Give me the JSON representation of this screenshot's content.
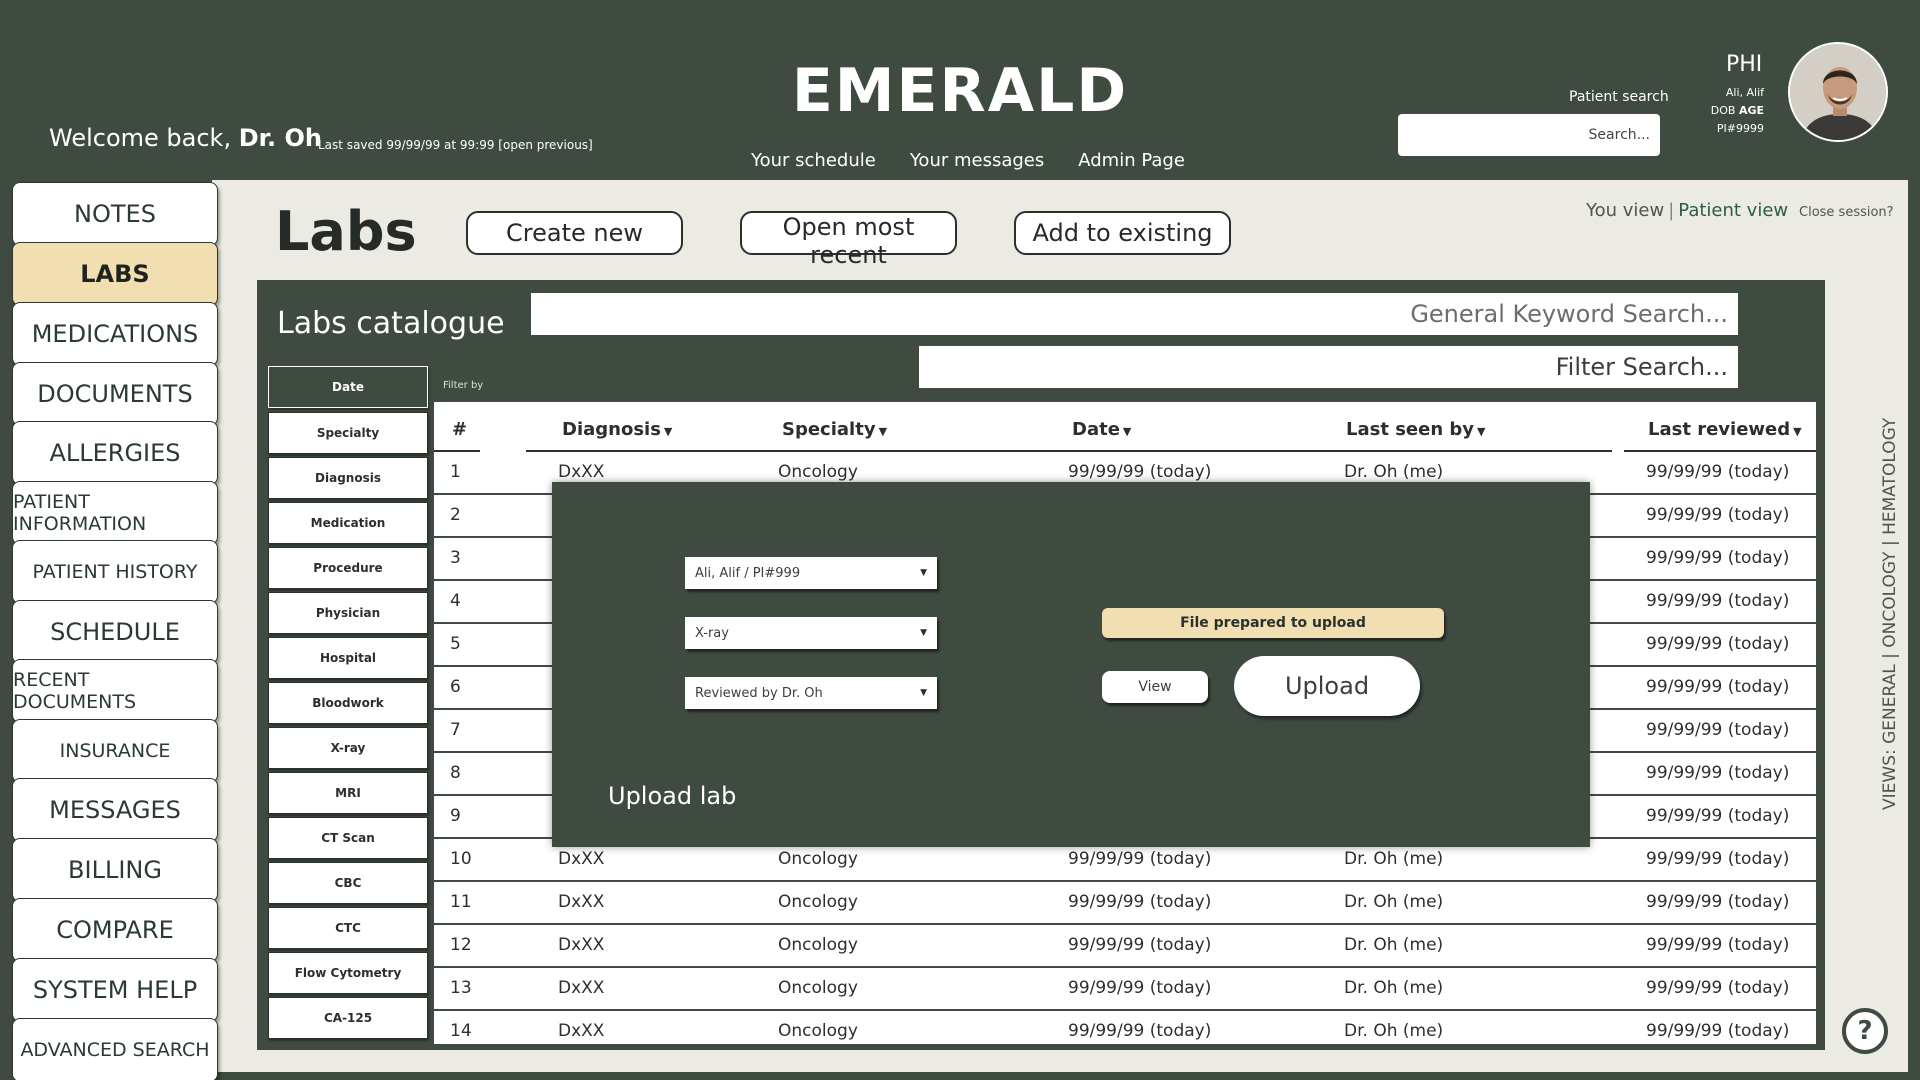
{
  "app": {
    "title": "EMERALD"
  },
  "header": {
    "welcome_prefix": "Welcome back, ",
    "welcome_user": "Dr. Oh",
    "last_saved": "Last saved 99/99/99 at 99:99  [open previous]",
    "nav": [
      "Your schedule",
      "Your messages",
      "Admin Page"
    ],
    "patient_search_label": "Patient search",
    "patient_search_placeholder": "Search..."
  },
  "phi": {
    "title": "PHI",
    "name": "Ali, Alif",
    "dob_label": "DOB",
    "age_label": "AGE",
    "id": "PI#9999",
    "avatar_icon": "user-photo"
  },
  "sidebar": {
    "items": [
      {
        "label": "NOTES",
        "active": false
      },
      {
        "label": "LABS",
        "active": true
      },
      {
        "label": "MEDICATIONS",
        "active": false
      },
      {
        "label": "DOCUMENTS",
        "active": false
      },
      {
        "label": "ALLERGIES",
        "active": false
      },
      {
        "label": "PATIENT INFORMATION",
        "active": false
      },
      {
        "label": "PATIENT HISTORY",
        "active": false
      },
      {
        "label": "SCHEDULE",
        "active": false
      },
      {
        "label": "RECENT DOCUMENTS",
        "active": false
      },
      {
        "label": "INSURANCE",
        "active": false
      },
      {
        "label": "MESSAGES",
        "active": false
      },
      {
        "label": "BILLING",
        "active": false
      },
      {
        "label": "COMPARE",
        "active": false
      },
      {
        "label": "SYSTEM HELP",
        "active": false
      },
      {
        "label": "ADVANCED SEARCH",
        "active": false
      }
    ]
  },
  "page": {
    "title": "Labs",
    "buttons": {
      "create": "Create new",
      "open_recent": "Open most recent",
      "add_existing": "Add to existing"
    },
    "view_toggle": {
      "you": "You view",
      "separator": "|",
      "patient": "Patient view"
    },
    "close_session": "Close session?"
  },
  "catalogue": {
    "title": "Labs catalogue",
    "keyword_placeholder": "General Keyword Search...",
    "filter_placeholder": "Filter Search...",
    "filter_by_label": "Filter by",
    "filters": [
      {
        "label": "Date",
        "active": true
      },
      {
        "label": "Specialty",
        "active": false
      },
      {
        "label": "Diagnosis",
        "active": false
      },
      {
        "label": "Medication",
        "active": false
      },
      {
        "label": "Procedure",
        "active": false
      },
      {
        "label": "Physician",
        "active": false
      },
      {
        "label": "Hospital",
        "active": false
      },
      {
        "label": "Bloodwork",
        "active": false
      },
      {
        "label": "X-ray",
        "active": false
      },
      {
        "label": "MRI",
        "active": false
      },
      {
        "label": "CT Scan",
        "active": false
      },
      {
        "label": "CBC",
        "active": false
      },
      {
        "label": "CTC",
        "active": false
      },
      {
        "label": "Flow Cytometry",
        "active": false
      },
      {
        "label": "CA-125",
        "active": false
      }
    ],
    "columns": [
      "#",
      "Diagnosis",
      "Specialty",
      "Date",
      "Last seen by",
      "Last reviewed"
    ],
    "sortable": [
      false,
      true,
      true,
      true,
      true,
      true
    ],
    "rows": [
      [
        "1",
        "DxXX",
        "Oncology",
        "99/99/99 (today)",
        "Dr. Oh (me)",
        "99/99/99 (today)"
      ],
      [
        "2",
        "",
        "",
        "",
        "",
        "99/99/99 (today)"
      ],
      [
        "3",
        "",
        "",
        "",
        "",
        "99/99/99 (today)"
      ],
      [
        "4",
        "",
        "",
        "",
        "",
        "99/99/99 (today)"
      ],
      [
        "5",
        "",
        "",
        "",
        "",
        "99/99/99 (today)"
      ],
      [
        "6",
        "",
        "",
        "",
        "",
        "99/99/99 (today)"
      ],
      [
        "7",
        "",
        "",
        "",
        "",
        "99/99/99 (today)"
      ],
      [
        "8",
        "",
        "",
        "",
        "",
        "99/99/99 (today)"
      ],
      [
        "9",
        "",
        "",
        "",
        "",
        "99/99/99 (today)"
      ],
      [
        "10",
        "DxXX",
        "Oncology",
        "99/99/99 (today)",
        "Dr. Oh (me)",
        "99/99/99 (today)"
      ],
      [
        "11",
        "DxXX",
        "Oncology",
        "99/99/99 (today)",
        "Dr. Oh (me)",
        "99/99/99 (today)"
      ],
      [
        "12",
        "DxXX",
        "Oncology",
        "99/99/99 (today)",
        "Dr. Oh (me)",
        "99/99/99 (today)"
      ],
      [
        "13",
        "DxXX",
        "Oncology",
        "99/99/99 (today)",
        "Dr. Oh (me)",
        "99/99/99 (today)"
      ],
      [
        "14",
        "DxXX",
        "Oncology",
        "99/99/99 (today)",
        "Dr. Oh (me)",
        "99/99/99 (today)"
      ]
    ]
  },
  "modal": {
    "title": "Upload lab",
    "patient_select": "Ali, Alif / PI#999",
    "type_select": "X-ray",
    "review_select": "Reviewed by Dr. Oh",
    "status": "File prepared to upload",
    "view_label": "View",
    "upload_label": "Upload"
  },
  "views_label": "VIEWS: GENERAL | ONCOLOGY | HEMATOLOGY",
  "help": {
    "label": "?",
    "icon": "help-icon"
  },
  "colors": {
    "primary": "#3f4b41",
    "accent": "#f2dfb1",
    "background": "#ebebe3"
  }
}
